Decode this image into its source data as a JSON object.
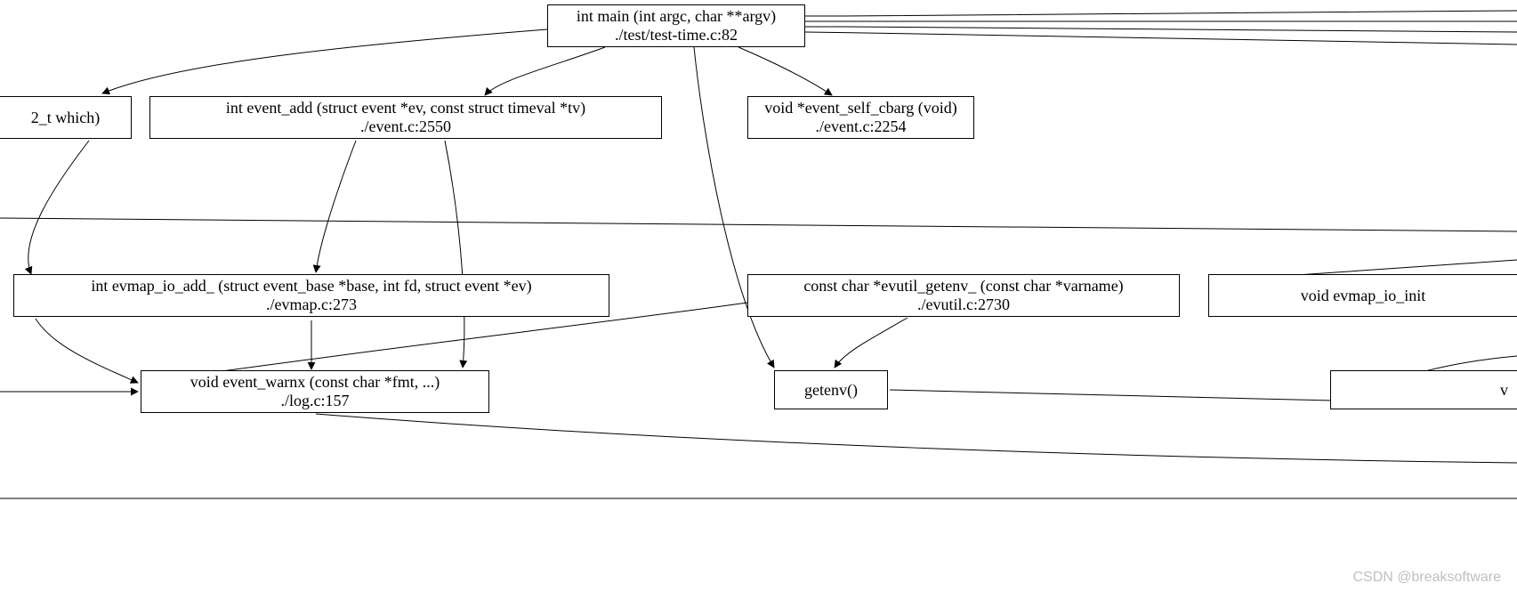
{
  "nodes": {
    "main": {
      "sig": "int main (int argc, char **argv)",
      "loc": "./test/test-time.c:82"
    },
    "which": {
      "sig": "2_t which)",
      "loc": ""
    },
    "event_add": {
      "sig": "int event_add (struct event *ev, const struct timeval *tv)",
      "loc": "./event.c:2550"
    },
    "self_cbarg": {
      "sig": "void *event_self_cbarg (void)",
      "loc": "./event.c:2254"
    },
    "evmap_io_add": {
      "sig": "int evmap_io_add_ (struct event_base *base, int fd, struct event *ev)",
      "loc": "./evmap.c:273"
    },
    "evutil_get": {
      "sig": "const char *evutil_getenv_ (const char *varname)",
      "loc": "./evutil.c:2730"
    },
    "evmap_io_init": {
      "sig": "void evmap_io_init",
      "loc": ""
    },
    "event_warnx": {
      "sig": "void event_warnx (const char *fmt, ...)",
      "loc": "./log.c:157"
    },
    "getenv": {
      "sig": "getenv()",
      "loc": ""
    },
    "v": {
      "sig": "v",
      "loc": ""
    }
  },
  "watermark": "CSDN @breaksoftware"
}
